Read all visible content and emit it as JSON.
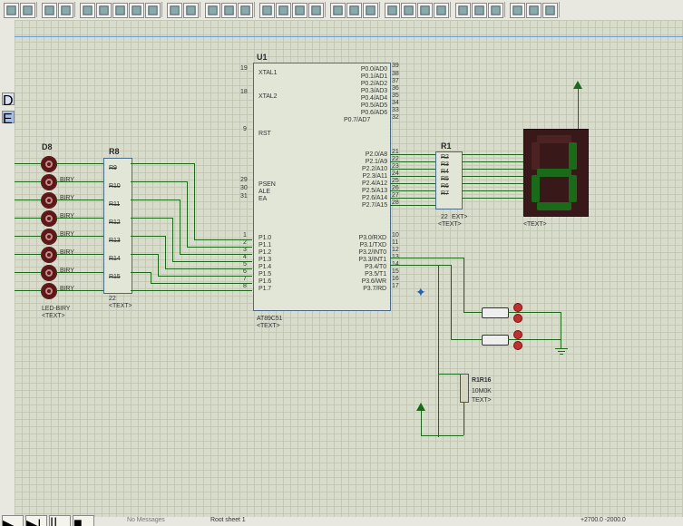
{
  "toolbar": {
    "icons": [
      "new-file-icon",
      "open-icon",
      "grid-toggle-icon",
      "center-icon",
      "pan-icon",
      "zoom-in-icon",
      "zoom-out-icon",
      "zoom-fit-icon",
      "zoom-area-icon",
      "undo-icon",
      "redo-icon",
      "cut-icon",
      "copy-icon",
      "paste-icon",
      "align-icon",
      "group-icon",
      "ungroup-icon",
      "layer-icon",
      "search-icon",
      "arc-icon",
      "refresh-icon",
      "design-explorer-icon",
      "find-icon",
      "tools-icon",
      "run-script-icon",
      "add-sheet-icon",
      "check-icon",
      "netlist-icon",
      "export-icon",
      "import-icon",
      "ares-icon"
    ]
  },
  "tabs": [
    "D",
    "E"
  ],
  "chip": {
    "ref": "U1",
    "part": "AT89C51",
    "text": "<TEXT>",
    "left_pins": [
      {
        "num": "19",
        "name": "XTAL1"
      },
      {
        "num": "18",
        "name": "XTAL2"
      },
      {
        "num": "9",
        "name": "RST"
      },
      {
        "num": "29",
        "name": "PSEN"
      },
      {
        "num": "30",
        "name": "ALE"
      },
      {
        "num": "31",
        "name": "EA"
      },
      {
        "num": "1",
        "name": "P1.0"
      },
      {
        "num": "2",
        "name": "P1.1"
      },
      {
        "num": "3",
        "name": "P1.2"
      },
      {
        "num": "4",
        "name": "P1.3"
      },
      {
        "num": "5",
        "name": "P1.4"
      },
      {
        "num": "6",
        "name": "P1.5"
      },
      {
        "num": "7",
        "name": "P1.6"
      },
      {
        "num": "8",
        "name": "P1.7"
      }
    ],
    "right_pins": [
      {
        "num": "39",
        "name": "P0.0/AD0"
      },
      {
        "num": "38",
        "name": "P0.1/AD1"
      },
      {
        "num": "37",
        "name": "P0.2/AD2"
      },
      {
        "num": "36",
        "name": "P0.3/AD3"
      },
      {
        "num": "35",
        "name": "P0.4/AD4"
      },
      {
        "num": "34",
        "name": "P0.5/AD5"
      },
      {
        "num": "33",
        "name": "P0.6/AD6"
      },
      {
        "num": "32",
        "name": "P0.7/AD7"
      },
      {
        "num": "21",
        "name": "P2.0/A8"
      },
      {
        "num": "22",
        "name": "P2.1/A9"
      },
      {
        "num": "23",
        "name": "P2.2/A10"
      },
      {
        "num": "24",
        "name": "P2.3/A11"
      },
      {
        "num": "25",
        "name": "P2.4/A12"
      },
      {
        "num": "26",
        "name": "P2.5/A13"
      },
      {
        "num": "27",
        "name": "P2.6/A14"
      },
      {
        "num": "28",
        "name": "P2.7/A15"
      },
      {
        "num": "10",
        "name": "P3.0/RXD"
      },
      {
        "num": "11",
        "name": "P3.1/TXD"
      },
      {
        "num": "12",
        "name": "P3.2/INT0"
      },
      {
        "num": "13",
        "name": "P3.3/INT1"
      },
      {
        "num": "14",
        "name": "P3.4/T0"
      },
      {
        "num": "15",
        "name": "P3.5/T1"
      },
      {
        "num": "16",
        "name": "P3.6/WR"
      },
      {
        "num": "17",
        "name": "P3.7/RD"
      }
    ]
  },
  "leds": {
    "ref": "D8",
    "part": "LED-BIRY",
    "text": "<TEXT>",
    "sublabel": "BIRY"
  },
  "resistors": {
    "bank_ref": "R8",
    "items": [
      "R9",
      "R10",
      "R11",
      "R12",
      "R13",
      "R14",
      "R15"
    ],
    "text": "<TEXT>",
    "pin22": "22"
  },
  "rpack": {
    "ref": "R1",
    "items": [
      "R2",
      "R3",
      "R4",
      "R5",
      "R6",
      "R7"
    ],
    "ext_label": "EXT>",
    "pin22": "22",
    "text": "<TEXT>"
  },
  "display_text": "<TEXT>",
  "res16": {
    "ref": "R1R16",
    "value": "10M0K",
    "text": "TEXT>"
  },
  "status": {
    "sheet": "Root sheet 1",
    "msg": "No Messages",
    "coords": "+2700.0   -2000.0"
  }
}
